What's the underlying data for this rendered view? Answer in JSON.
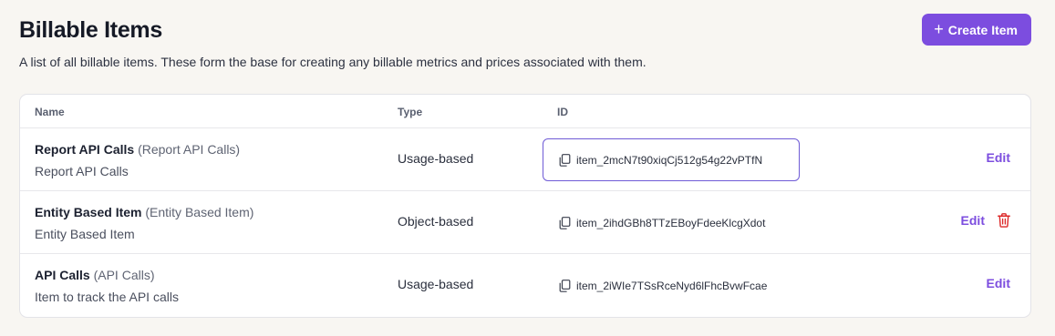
{
  "header": {
    "title": "Billable Items",
    "description": "A list of all billable items. These form the base for creating any billable metrics and prices associated with them.",
    "create_button": "Create Item",
    "create_icon": "+"
  },
  "table": {
    "columns": [
      "Name",
      "Type",
      "ID"
    ],
    "rows": [
      {
        "name": "Report API Calls",
        "alias": "(Report API Calls)",
        "description": "Report API Calls",
        "type": "Usage-based",
        "id": "item_2mcN7t90xiqCj512g54g22vPTfN",
        "edit": "Edit"
      },
      {
        "name": "Entity Based Item",
        "alias": "(Entity Based Item)",
        "description": "Entity Based Item",
        "type": "Object-based",
        "id": "item_2ihdGBh8TTzEBoyFdeeKlcgXdot",
        "edit": "Edit"
      },
      {
        "name": "API Calls",
        "alias": "(API Calls)",
        "description": "Item to track the API calls",
        "type": "Usage-based",
        "id": "item_2iWIe7TSsRceNyd6lFhcBvwFcae",
        "edit": "Edit"
      }
    ]
  },
  "colors": {
    "accent": "#7c4ddf",
    "delete": "#dc2626",
    "page_bg": "#f8f6f2"
  },
  "icons": {
    "copy": "copy-icon",
    "delete": "trash-icon",
    "add": "plus-icon"
  }
}
